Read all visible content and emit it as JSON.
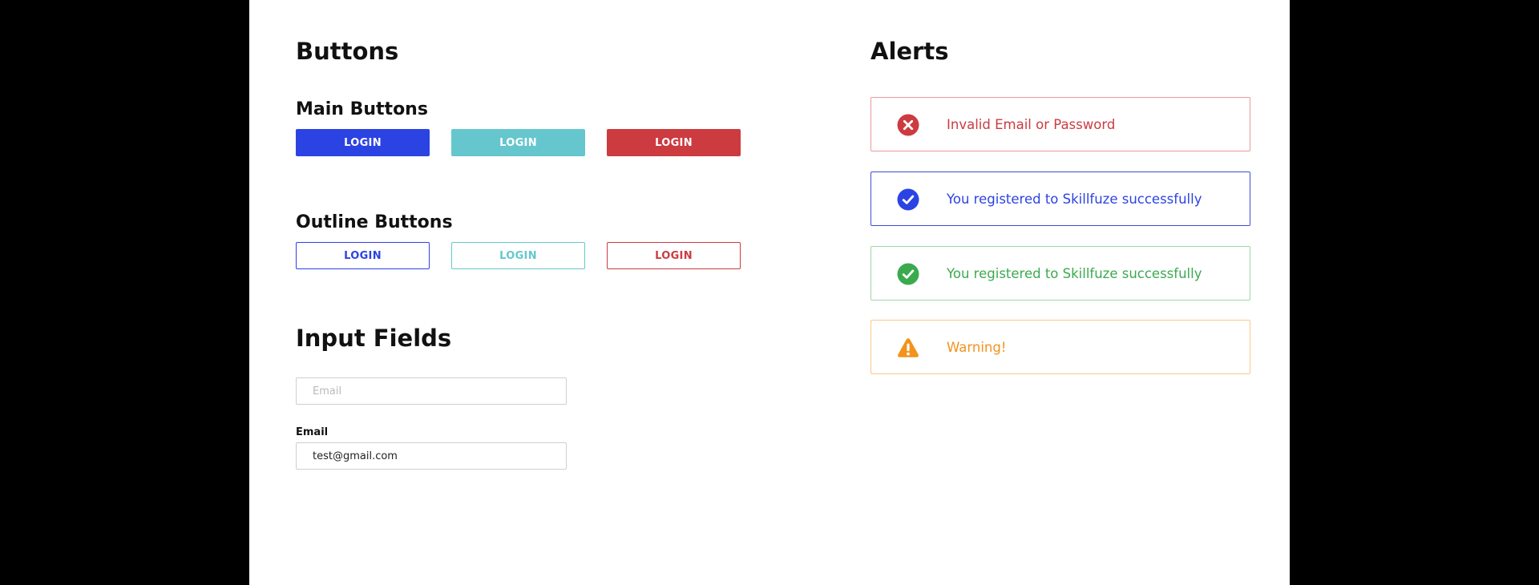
{
  "buttons_section": {
    "title": "Buttons",
    "main_title": "Main Buttons",
    "outline_title": "Outline Buttons",
    "main_buttons": [
      {
        "label": "LOGIN",
        "color": "#2c43e3"
      },
      {
        "label": "LOGIN",
        "color": "#65c7cd"
      },
      {
        "label": "LOGIN",
        "color": "#cc3b40"
      }
    ],
    "outline_buttons": [
      {
        "label": "LOGIN",
        "color": "#2c43e3"
      },
      {
        "label": "LOGIN",
        "color": "#65c7cd"
      },
      {
        "label": "LOGIN",
        "color": "#cc3b40"
      }
    ]
  },
  "inputs_section": {
    "title": "Input Fields",
    "email_placeholder": "Email",
    "email_label": "Email",
    "email_value": "test@gmail.com"
  },
  "alerts_section": {
    "title": "Alerts",
    "alerts": [
      {
        "type": "error",
        "icon": "x-circle-icon",
        "message": "Invalid Email or Password",
        "color": "#cc3b40",
        "border": "#e79a9d"
      },
      {
        "type": "info",
        "icon": "check-circle-icon",
        "message": "You registered to Skillfuze successfully",
        "color": "#2c43e3",
        "border": "#3d4fd7"
      },
      {
        "type": "success",
        "icon": "check-circle-icon",
        "message": "You registered to Skillfuze successfully",
        "color": "#3aaa4f",
        "border": "#9fd6a8"
      },
      {
        "type": "warning",
        "icon": "warning-triangle-icon",
        "message": "Warning!",
        "color": "#f2931c",
        "border": "#f7c98c"
      }
    ]
  }
}
